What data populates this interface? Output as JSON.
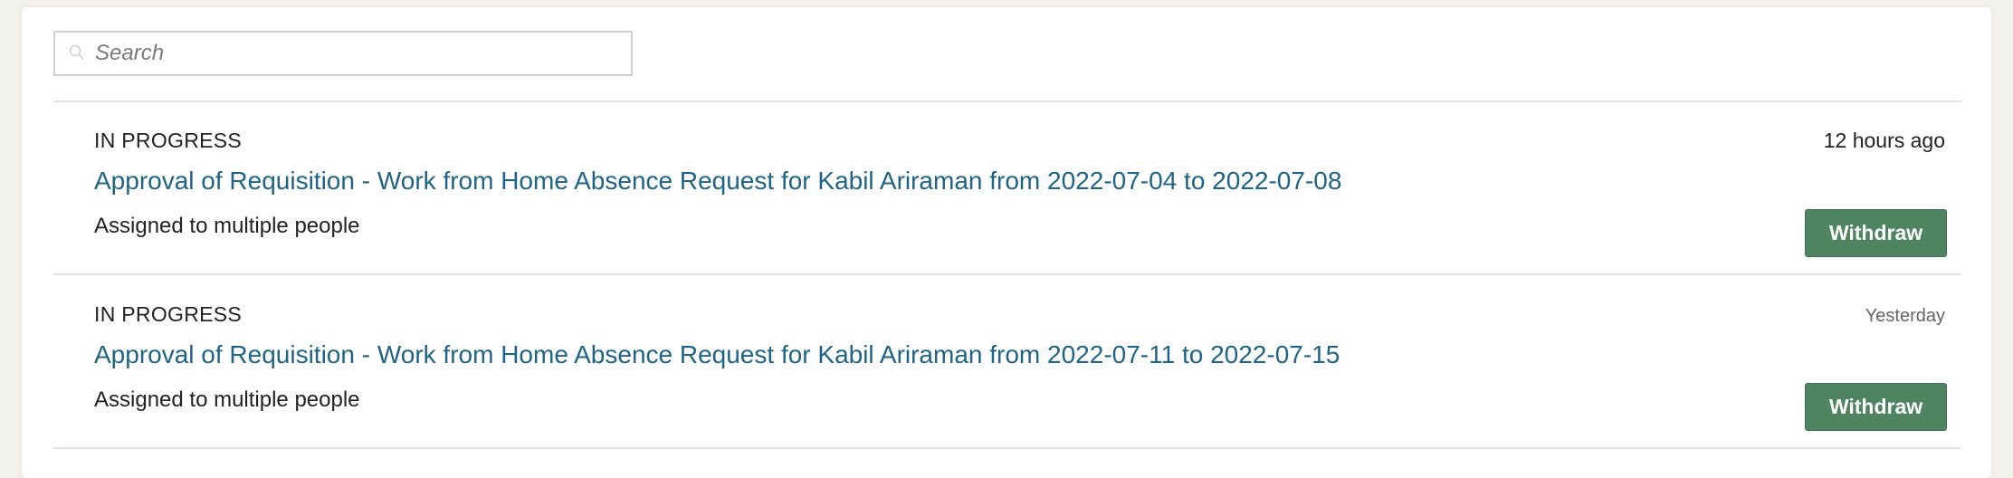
{
  "search": {
    "placeholder": "Search",
    "icon": "search-icon"
  },
  "items": [
    {
      "status": "IN PROGRESS",
      "time": "12 hours ago",
      "title": "Approval of Requisition - Work from Home Absence Request for Kabil Ariraman from 2022-07-04 to 2022-07-08",
      "assignee": "Assigned to multiple people",
      "action": "Withdraw"
    },
    {
      "status": "IN PROGRESS",
      "time": "Yesterday",
      "title": "Approval of Requisition - Work from Home Absence Request for Kabil Ariraman from 2022-07-11 to 2022-07-15",
      "assignee": "Assigned to multiple people",
      "action": "Withdraw"
    }
  ],
  "colors": {
    "link": "#1f6484",
    "button": "#4f8461"
  }
}
